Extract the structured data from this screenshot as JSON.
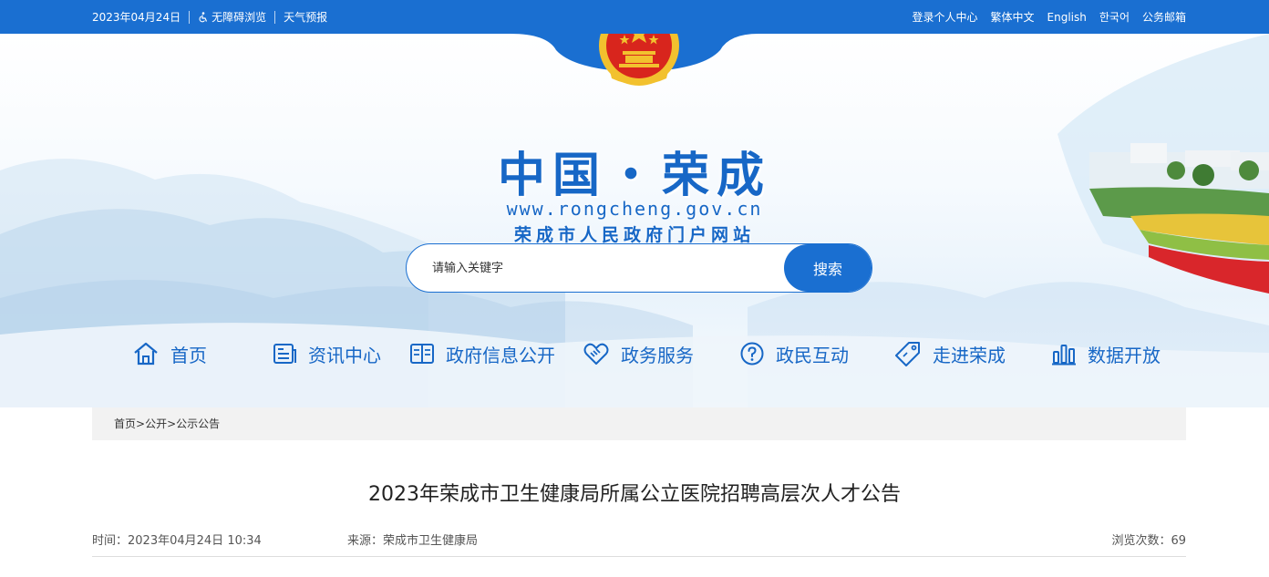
{
  "topbar": {
    "date": "2023年04月24日",
    "accessibility": "无障碍浏览",
    "weather": "天气预报",
    "links": [
      "登录个人中心",
      "繁体中文",
      "English",
      "한국어",
      "公务邮箱"
    ]
  },
  "header": {
    "title": "中国・荣成",
    "url": "www.rongcheng.gov.cn",
    "subtitle": "荣成市人民政府门户网站"
  },
  "search": {
    "placeholder": "请输入关键字",
    "button": "搜索"
  },
  "nav": {
    "items": [
      {
        "label": "首页",
        "icon": "home-icon"
      },
      {
        "label": "资讯中心",
        "icon": "news-icon"
      },
      {
        "label": "政府信息公开",
        "icon": "book-icon"
      },
      {
        "label": "政务服务",
        "icon": "handshake-icon"
      },
      {
        "label": "政民互动",
        "icon": "question-icon"
      },
      {
        "label": "走进荣成",
        "icon": "tag-icon"
      },
      {
        "label": "数据开放",
        "icon": "bar-chart-icon"
      }
    ]
  },
  "breadcrumb": {
    "items": [
      "首页",
      "公开",
      "公示公告"
    ],
    "separator": ">"
  },
  "article": {
    "title": "2023年荣成市卫生健康局所属公立医院招聘高层次人才公告",
    "time_label": "时间：",
    "time": "2023年04月24日 10:34",
    "source_label": "来源：",
    "source": "荣成市卫生健康局",
    "views_label": "浏览次数：",
    "views": "69"
  },
  "colors": {
    "primary": "#1a6fd1",
    "title_blue": "#1767c6",
    "emblem_red": "#d8251d",
    "emblem_gold": "#f2c12e"
  }
}
